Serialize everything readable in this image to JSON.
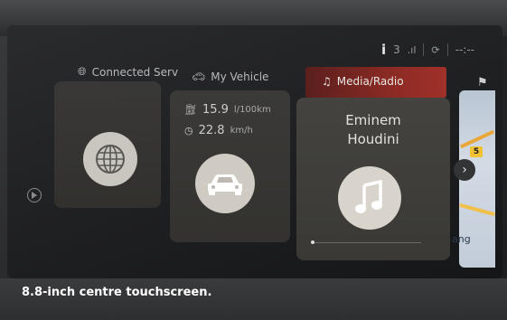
{
  "status_bar": {
    "info_icon": "i",
    "badge_count": "3",
    "signal_label": ".ıl",
    "clock": "--:--"
  },
  "cards": {
    "connected": {
      "title": "Connected Serv",
      "icon": "globe-icon"
    },
    "vehicle": {
      "title": "My Vehicle",
      "icon": "car-icon",
      "fuel_value": "15.9",
      "fuel_unit": "l/100km",
      "speed_value": "22.8",
      "speed_unit": "km/h"
    },
    "media": {
      "title": "Media/Radio",
      "icon": "music-note-icon",
      "artist": "Eminem",
      "track": "Houdini"
    }
  },
  "map": {
    "route_badge": "5",
    "place_label": "ang"
  },
  "caption": "8.8-inch centre touchscreen.",
  "colors": {
    "accent_red": "#8b2a24",
    "tile": "#3b3a38",
    "circle": "#d9d6cf",
    "map_water": "#c2ccd8",
    "route": "#e9a73a"
  }
}
